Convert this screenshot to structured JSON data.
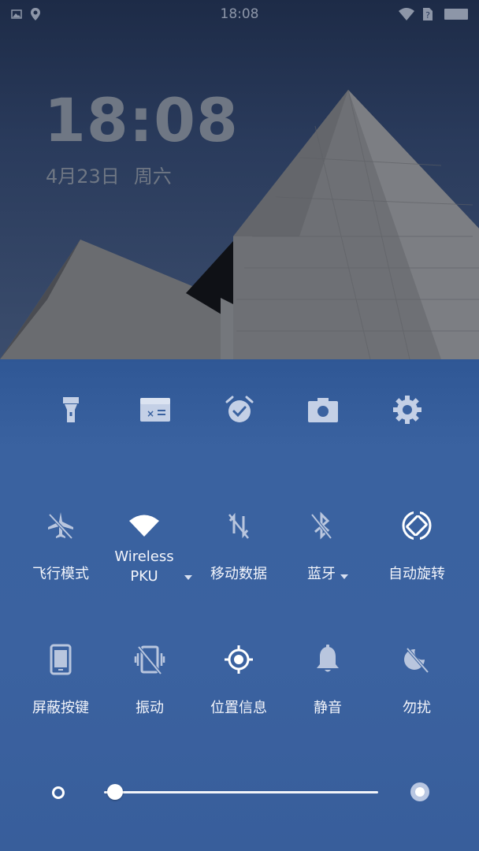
{
  "status_bar": {
    "time": "18:08",
    "left_icons": [
      "image-icon",
      "location-pin-icon"
    ],
    "right_icons": [
      "wifi-icon",
      "sim-unknown-icon",
      "battery-icon"
    ]
  },
  "lock": {
    "clock": "18:08",
    "date": "4月23日",
    "weekday": "周六"
  },
  "shortcuts": [
    {
      "name": "flashlight-icon"
    },
    {
      "name": "calculator-icon"
    },
    {
      "name": "alarm-clock-icon"
    },
    {
      "name": "camera-icon"
    },
    {
      "name": "settings-gear-icon"
    }
  ],
  "tiles_row1": [
    {
      "label": "飞行模式",
      "icon": "airplane-off-icon"
    },
    {
      "label_line1": "Wireless",
      "label_line2": "PKU",
      "icon": "wifi-icon",
      "dropdown": true
    },
    {
      "label": "移动数据",
      "icon": "mobile-data-off-icon"
    },
    {
      "label": "蓝牙",
      "icon": "bluetooth-off-icon",
      "dropdown": true
    },
    {
      "label": "自动旋转",
      "icon": "auto-rotate-icon"
    }
  ],
  "tiles_row2": [
    {
      "label": "屏蔽按键",
      "icon": "phone-icon"
    },
    {
      "label": "振动",
      "icon": "vibrate-off-icon"
    },
    {
      "label": "位置信息",
      "icon": "location-target-icon"
    },
    {
      "label": "静音",
      "icon": "bell-icon"
    },
    {
      "label": "勿扰",
      "icon": "do-not-disturb-icon"
    }
  ],
  "brightness": {
    "level": 0.04
  },
  "colors": {
    "panel": "#3a62a0",
    "tile_active": "#ffffff",
    "tile_inactive": "#b9c6de"
  }
}
